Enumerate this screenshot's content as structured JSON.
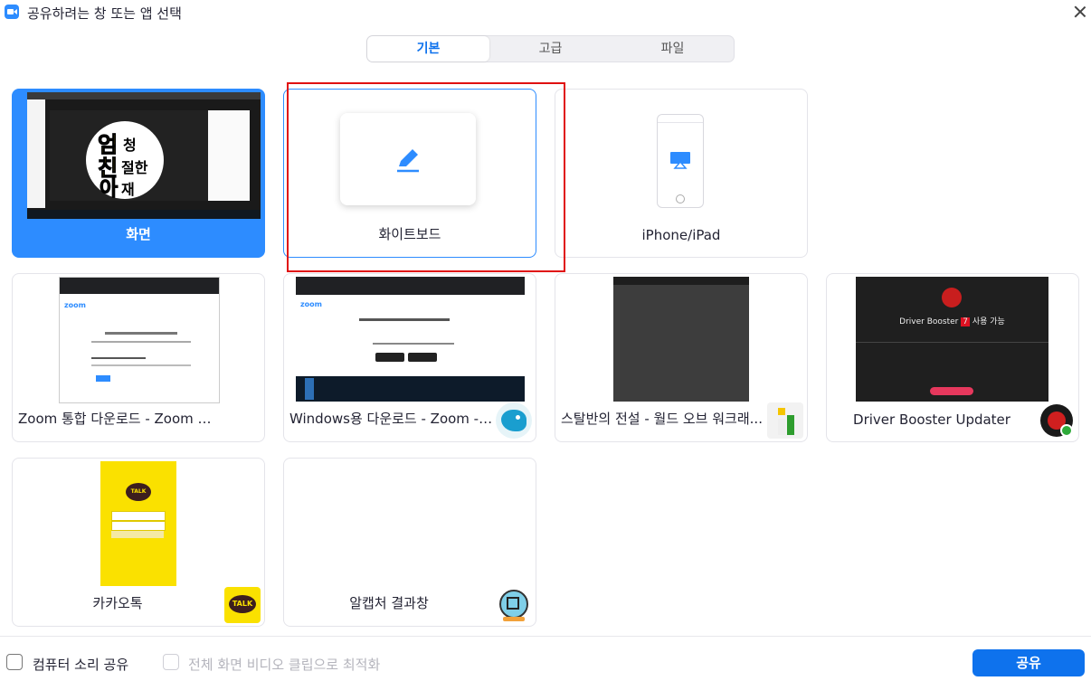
{
  "window": {
    "title": "공유하려는 창 또는 앱 선택"
  },
  "tabs": [
    {
      "label": "기본",
      "active": true
    },
    {
      "label": "고급",
      "active": false
    },
    {
      "label": "파일",
      "active": false
    }
  ],
  "cards": {
    "screen": {
      "label": "화면",
      "selected": true,
      "thumb_text": [
        "엄",
        "청",
        "친",
        "절한",
        "아",
        "재"
      ]
    },
    "whiteboard": {
      "label": "화이트보드"
    },
    "iphone": {
      "label": "iPhone/iPad"
    },
    "zoom_download": {
      "label": "Zoom 통합 다운로드 - Zoom 및 ..."
    },
    "windows_download": {
      "label": "Windows용 다운로드 - Zoom - W..."
    },
    "starcraft": {
      "label": "스탈반의 전설 - 월드 오브 워크래..."
    },
    "driver_booster": {
      "label": "Driver Booster Updater",
      "thumb_title": "Driver Booster",
      "thumb_badge": "7",
      "thumb_suffix": "사용 가능"
    },
    "kakaotalk": {
      "label": "카카오톡",
      "thumb_logo": "TALK"
    },
    "alcapture": {
      "label": "알캡처 결과창"
    }
  },
  "footer": {
    "share_audio_label": "컴퓨터 소리 공유",
    "optimize_video_label": "전체 화면 비디오 클립으로 최적화",
    "share_button_label": "공유"
  },
  "colors": {
    "accent": "#2d8cff",
    "primary_button": "#0e72ed",
    "highlight_box": "#e01010"
  }
}
